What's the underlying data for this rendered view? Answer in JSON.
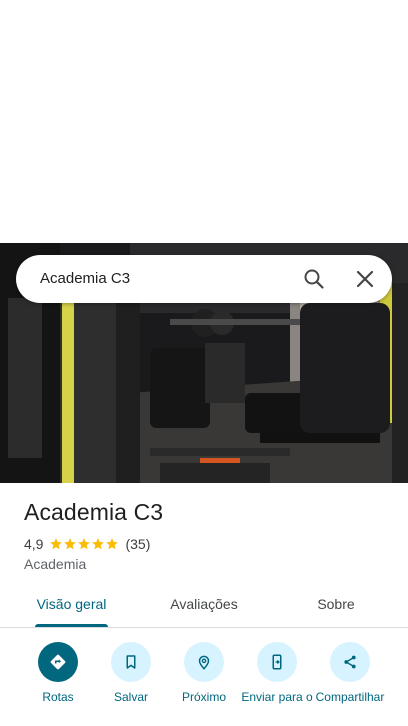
{
  "search": {
    "query": "Academia C3"
  },
  "place": {
    "name": "Academia C3",
    "rating": "4,9",
    "review_count": "(35)",
    "stars": 5,
    "category": "Academia"
  },
  "tabs": [
    {
      "label": "Visão geral",
      "active": true
    },
    {
      "label": "Avaliações",
      "active": false
    },
    {
      "label": "Sobre",
      "active": false
    }
  ],
  "actions": [
    {
      "label": "Rotas",
      "icon": "directions-icon"
    },
    {
      "label": "Salvar",
      "icon": "bookmark-icon"
    },
    {
      "label": "Próximo",
      "icon": "nearby-icon"
    },
    {
      "label": "Enviar para o",
      "icon": "send-to-phone-icon"
    },
    {
      "label": "Compartilhar",
      "icon": "share-icon"
    }
  ],
  "colors": {
    "accent": "#00677f",
    "action_bg": "#d7f3ff",
    "star": "#fbbc04"
  }
}
